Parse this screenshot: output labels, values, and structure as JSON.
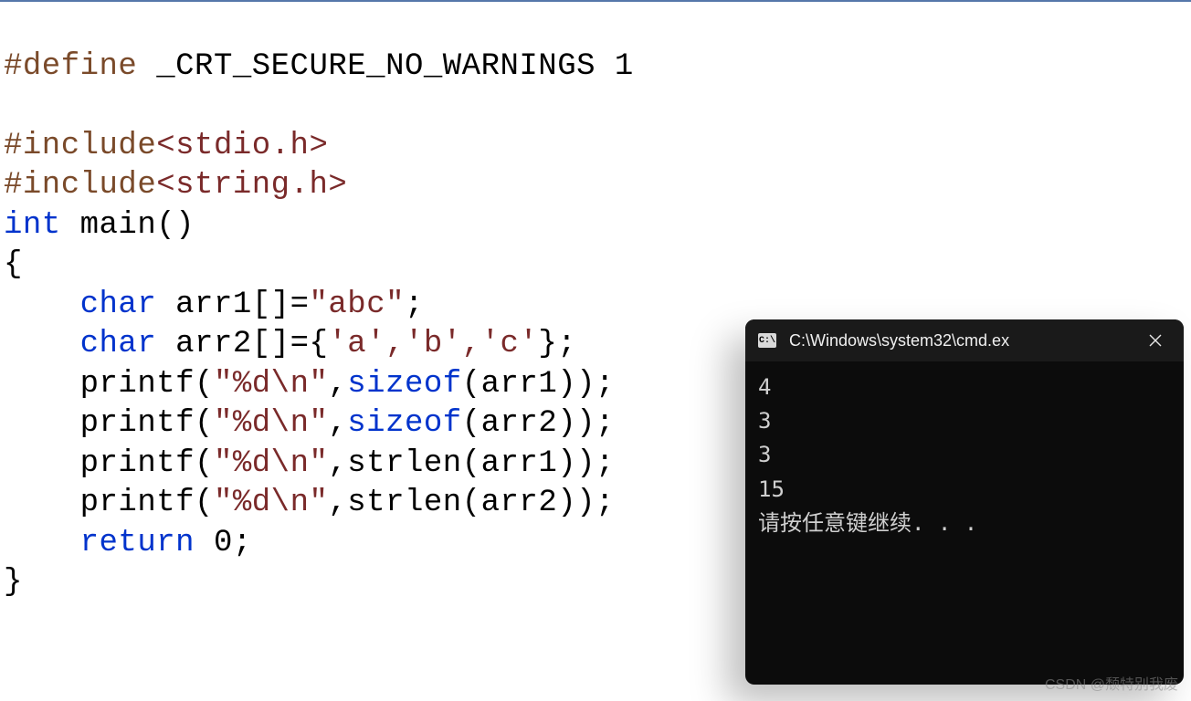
{
  "code": {
    "define_kw": "#define",
    "define_rest": " _CRT_SECURE_NO_WARNINGS 1",
    "include_kw": "#include",
    "inc1": "<stdio.h>",
    "inc2": "<string.h>",
    "int_kw": "int",
    "main_sig": " main()",
    "brace_open": "{",
    "indent": "    ",
    "char_kw": "char",
    "arr1_decl": " arr1[]=",
    "arr1_val": "\"abc\"",
    "semi": ";",
    "arr2_decl": " arr2[]={",
    "arr2_chars": "'a','b','c'",
    "arr2_end": "};",
    "printf1a": "printf(",
    "fmt": "\"%d\\n\"",
    "comma": ",",
    "sizeof_kw": "sizeof",
    "arr1_ref": "(arr1));",
    "arr2_ref": "(arr2));",
    "strlen_fn": "strlen",
    "return_kw": "return",
    "return_rest": " 0;",
    "brace_close": "}"
  },
  "console": {
    "title": "C:\\Windows\\system32\\cmd.ex",
    "icon_text": "C:\\",
    "lines": {
      "l1": "4",
      "l2": "3",
      "l3": "3",
      "l4": "15",
      "l5": "请按任意键继续. . ."
    }
  },
  "watermark": "CSDN @颓特别我废"
}
